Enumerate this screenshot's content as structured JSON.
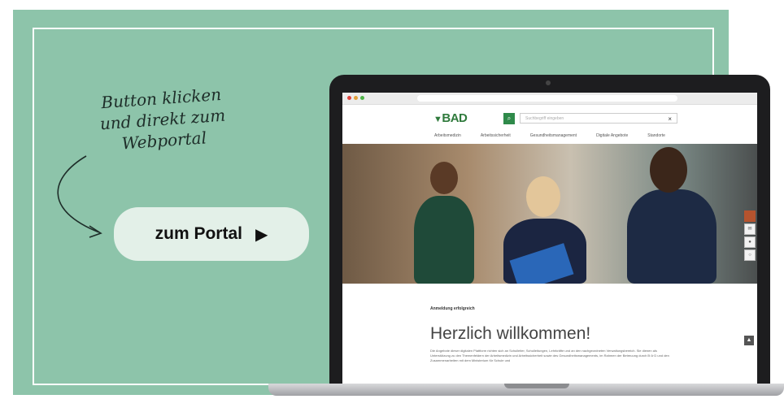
{
  "promo": {
    "note_line1": "Button klicken",
    "note_line2": "und direkt zum",
    "note_line3": "Webportal",
    "button_label": "zum Portal",
    "button_icon": "▶"
  },
  "colors": {
    "panel": "#8dc4aa",
    "button_bg": "#e3f0e8",
    "brand_green": "#2f7a3c"
  },
  "website": {
    "logo_text": "BAD",
    "search_placeholder": "Suchbegriff eingeben",
    "search_close": "×",
    "nav": [
      "Arbeitsmedizin",
      "Arbeitssicherheit",
      "Gesundheitsmanagement",
      "Digitale Angebote",
      "Standorte"
    ],
    "login_msg": "Anmeldung erfolgreich",
    "welcome": "Herzlich willkommen!",
    "paragraph": "Die Angebote dieser digitalen Plattform richten sich an Schulleiter, Schulleitungen, Lehrkräfte und an den nachgeordneten Verwaltungsbereich. Sie dienen als Unterstützung zu den Themenfeldern der Arbeitsmedizin und Arbeitssicherheit sowie des Gesundheitsmanagements, im Rahmen der Betreuung durch B·A·D und den Zusammenarbeiten mit dem Ministerium für Schule und"
  }
}
